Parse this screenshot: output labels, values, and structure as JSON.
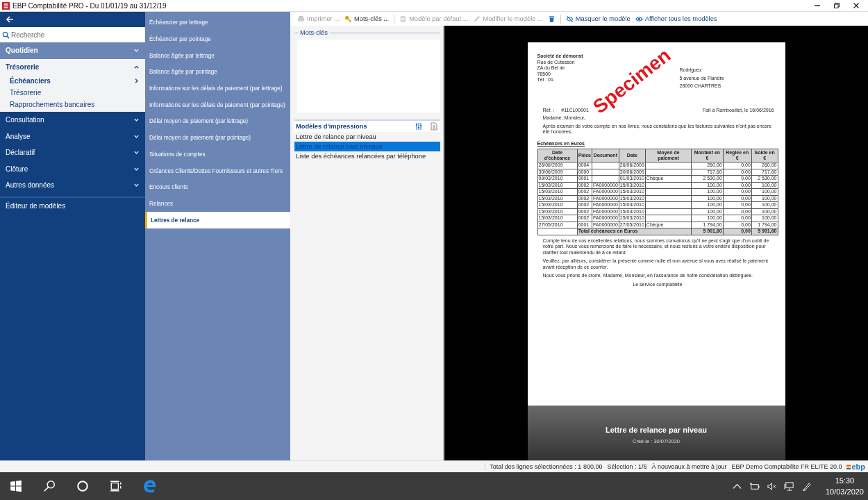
{
  "window": {
    "title": "EBP Comptabilité PRO - Du 01/01/19 au 31/12/19"
  },
  "sidebar": {
    "search": {
      "placeholder": "Recherche"
    },
    "sections": [
      {
        "label": "Quotidien",
        "expanded": false,
        "highlighted": true
      },
      {
        "label": "Trésorerie",
        "expanded": true,
        "highlighted": false,
        "children": [
          {
            "label": "Échéanciers",
            "selected": true,
            "has_submenu": true
          },
          {
            "label": "Trésorerie",
            "selected": false,
            "has_submenu": false
          },
          {
            "label": "Rapprochements bancaires",
            "selected": false,
            "has_submenu": false
          }
        ]
      },
      {
        "label": "Consultation",
        "expanded": false,
        "highlighted": false
      },
      {
        "label": "Analyse",
        "expanded": false,
        "highlighted": false
      },
      {
        "label": "Déclaratif",
        "expanded": false,
        "highlighted": false
      },
      {
        "label": "Clôture",
        "expanded": false,
        "highlighted": false
      },
      {
        "label": "Autres données",
        "expanded": false,
        "highlighted": false
      }
    ],
    "footer_item": "Éditeur de modèles"
  },
  "submenu": [
    {
      "label": "Échéancier par lettrage",
      "selected": false
    },
    {
      "label": "Échéancier par pointage",
      "selected": false
    },
    {
      "label": "Balance âgée par lettrage",
      "selected": false
    },
    {
      "label": "Balance âgée par pointage",
      "selected": false
    },
    {
      "label": "Informations sur les délais de paiement (par lettrage)",
      "selected": false
    },
    {
      "label": "Informations sur les délais de paiement (par pointage)",
      "selected": false
    },
    {
      "label": "Délai moyen de paiement (par lettrage)",
      "selected": false
    },
    {
      "label": "Délai moyen de paiement (par pointage)",
      "selected": false
    },
    {
      "label": "Situations de comptes",
      "selected": false
    },
    {
      "label": "Créances Clients/Dettes Fournisseurs et autres Tiers",
      "selected": false
    },
    {
      "label": "Encours clients",
      "selected": false
    },
    {
      "label": "Relances",
      "selected": false
    },
    {
      "label": "Lettres de relance",
      "selected": true
    }
  ],
  "toolbar": {
    "groups": [
      [
        {
          "kind": "print",
          "label": "Imprimer ...",
          "disabled": true
        },
        {
          "kind": "keys",
          "label": "Mots-clés ...",
          "disabled": false
        }
      ],
      [
        {
          "kind": "default",
          "label": "Modèle par défaut ...",
          "disabled": true
        },
        {
          "kind": "edit",
          "label": "Modifier le modèle ...",
          "disabled": true
        },
        {
          "kind": "delete",
          "disabled": false
        }
      ],
      [
        {
          "kind": "hide",
          "label": "Masquer le modèle",
          "disabled": false
        },
        {
          "kind": "show",
          "label": "Afficher tous les modèles",
          "disabled": false
        }
      ]
    ]
  },
  "keywords": {
    "title": "Mots-clés"
  },
  "models": {
    "title": "Modèles d'impressions",
    "items": [
      {
        "label": "Lettre de relance par niveau",
        "selected": false
      },
      {
        "label": "Lettre de relance tous niveaux",
        "selected": true
      },
      {
        "label": "Liste des échéances relancées par téléphone",
        "selected": false
      }
    ]
  },
  "preview": {
    "document": {
      "stamp": "Specimen",
      "sender": [
        "Société de démonst",
        "Rue de Cutesson",
        "ZA du Bel air",
        "78500",
        "Tél : 01."
      ],
      "recipient": [
        "Rodriguez",
        "5 avenue de Flandre",
        "28000 CHARTRES"
      ],
      "ref_label": "Réf. :",
      "ref": "#11CL00001",
      "place_date": "Fait à Rambouillet, le 16/06/2016",
      "salutation": "Madame, Monsieur,",
      "intro": "Après examen de votre compte en nos livres, nous constatons que les factures suivantes n'ont pas encore été honorées.",
      "table_title": "Échéances en Euros",
      "columns": [
        "Date d'échéance",
        "Pièce",
        "Document",
        "Date",
        "Moyen de paiement",
        "Montant en €",
        "Réglée en €",
        "Solde en €"
      ],
      "rows": [
        [
          "26/06/2009",
          "0004",
          "",
          "26/06/2009",
          "",
          "260,00",
          "0,00",
          "260,00"
        ],
        [
          "30/06/2009",
          "0000",
          "",
          "30/06/2009",
          "",
          "717,60",
          "0,00",
          "717,60"
        ],
        [
          "09/03/2010",
          "0001",
          "",
          "01/03/2010",
          "Chèque",
          "2 530,00",
          "0,00",
          "2 530,00"
        ],
        [
          "15/03/2010",
          "0002",
          "FA0000000",
          "15/03/2010",
          "",
          "100,00",
          "0,00",
          "100,00"
        ],
        [
          "15/03/2010",
          "0002",
          "FA0000000",
          "15/03/2010",
          "",
          "100,00",
          "0,00",
          "100,00"
        ],
        [
          "15/03/2010",
          "0002",
          "FA0000000",
          "15/03/2010",
          "",
          "100,00",
          "0,00",
          "100,00"
        ],
        [
          "15/03/2010",
          "0002",
          "FA0000000",
          "15/03/2010",
          "",
          "100,00",
          "0,00",
          "100,00"
        ],
        [
          "15/03/2010",
          "0002",
          "FA0000000",
          "15/03/2010",
          "",
          "100,00",
          "0,00",
          "100,00"
        ],
        [
          "15/03/2010",
          "0002",
          "FA0000000",
          "15/03/2010",
          "",
          "100,00",
          "0,00",
          "100,00"
        ],
        [
          "27/05/2010",
          "0001",
          "FA0000000",
          "27/05/2010",
          "Chèque",
          "1 794,00",
          "0,00",
          "1 794,00"
        ]
      ],
      "total": {
        "label": "Total échéances en Euros",
        "values": [
          "5 901,60",
          "0,00",
          "5 901,60"
        ]
      },
      "paragraphs": [
        "Compte tenu de nos excellentes relations, nous sommes convaincus qu'il ne peut s'agir que d'un oubli de votre part. Nous vous remercions de faire le nécessaire, et nous restons à votre entière disposition pour clarifier tout malentendu lié à ce retard.",
        "Veuillez, par ailleurs, considérer la présente comme nulle et non avenue si vous avez réalisé le paiement avant réception de ce courrier.",
        "Nous vous prions de croire, Madame, Monsieur, en l'assurance de notre considération distinguée."
      ],
      "signature": "Le service comptabilité"
    },
    "caption": {
      "title": "Lettre de relance par niveau",
      "created": "Créé le : 30/07/2020"
    }
  },
  "status_bar": {
    "items": [
      "Total des lignes sélectionnées : 1 800,00",
      "Sélection : 1/6",
      "À nouveaux à mettre à jour",
      "EBP Demo Comptabilite FR ELITE 20.0"
    ],
    "logo": "ebp"
  },
  "taskbar": {
    "time": "15:30",
    "date": "10/03/2020"
  }
}
